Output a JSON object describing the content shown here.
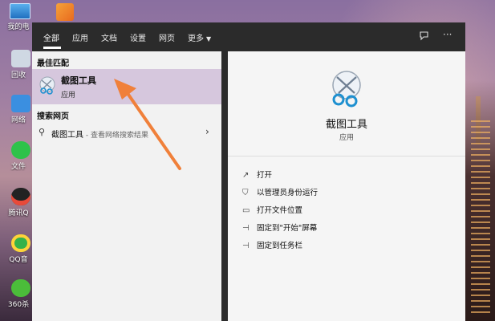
{
  "desktop": {
    "icons": [
      {
        "label": "我的电",
        "icon": "computer-icon",
        "color": "#3b8fe0"
      },
      {
        "label": "回收",
        "icon": "recycle-bin-icon",
        "color": "#cfd8e3"
      },
      {
        "label": "网络",
        "icon": "network-icon",
        "color": "#3b8fe0"
      },
      {
        "label": "文件",
        "icon": "wechat-icon",
        "color": "#2ec24a"
      },
      {
        "label": "腾讯Q",
        "icon": "qq-icon",
        "color": "#e84a3a"
      },
      {
        "label": "QQ音",
        "icon": "qq-music-icon",
        "color": "#35b24a"
      },
      {
        "label": "360杀",
        "icon": "antivirus-icon",
        "color": "#4bbd3a"
      }
    ]
  },
  "tabs": [
    {
      "label": "全部",
      "active": true
    },
    {
      "label": "应用"
    },
    {
      "label": "文档"
    },
    {
      "label": "设置"
    },
    {
      "label": "网页"
    },
    {
      "label": "更多"
    }
  ],
  "results": {
    "best_match_title": "最佳匹配",
    "best_match": {
      "name": "截图工具",
      "type": "应用"
    },
    "web_title": "搜索网页",
    "web_item": {
      "query": "截图工具",
      "suffix": " - 查看网络搜索结果"
    }
  },
  "detail": {
    "name": "截图工具",
    "type": "应用",
    "actions": [
      {
        "label": "打开",
        "icon": "open-icon"
      },
      {
        "label": "以管理员身份运行",
        "icon": "admin-icon"
      },
      {
        "label": "打开文件位置",
        "icon": "folder-icon"
      },
      {
        "label": "固定到\"开始\"屏幕",
        "icon": "pin-icon"
      },
      {
        "label": "固定到任务栏",
        "icon": "pin-icon"
      }
    ]
  },
  "annotation_color": "#f0803a"
}
